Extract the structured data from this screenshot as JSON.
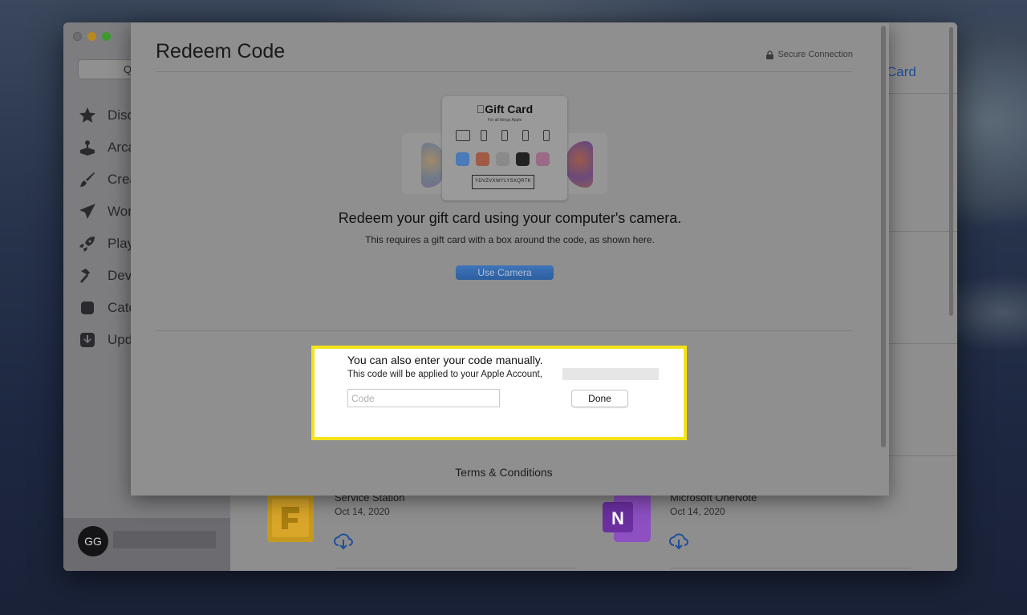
{
  "sidebar": {
    "search_hint": "Q",
    "items": [
      {
        "label": "Disc",
        "icon": "star-icon"
      },
      {
        "label": "Arca",
        "icon": "joystick-icon"
      },
      {
        "label": "Crea",
        "icon": "brush-icon"
      },
      {
        "label": "Wor",
        "icon": "paper-plane-icon"
      },
      {
        "label": "Play",
        "icon": "rocket-icon"
      },
      {
        "label": "Dev",
        "icon": "hammer-icon"
      },
      {
        "label": "Cate",
        "icon": "stack-icon"
      },
      {
        "label": "Upd",
        "icon": "download-arrow-icon"
      }
    ],
    "account": {
      "initials": "GG"
    }
  },
  "content": {
    "header_link": "Card",
    "apps": [
      {
        "name": "Service Station",
        "date": "Oct 14, 2020"
      },
      {
        "name": "Microsoft OneNote",
        "date": "Oct 14, 2020",
        "icon_letter": "N"
      }
    ]
  },
  "sheet": {
    "title": "Redeem Code",
    "secure_label": "Secure Connection",
    "gift_card": {
      "logo": "Gift Card",
      "tagline": "For all things Apple",
      "sample_code": "YDVZVXWYLYSXQRTK"
    },
    "camera_heading": "Redeem your gift card using your computer's camera.",
    "camera_sub": "This requires a gift card with a box around the code, as shown here.",
    "camera_button": "Use Camera",
    "manual_heading": "You can also enter your code manually.",
    "manual_sub": "This code will be applied to your Apple Account,",
    "code_placeholder": "Code",
    "done_button": "Done",
    "terms": "Terms & Conditions"
  },
  "colors": {
    "highlight": "#f5e31a",
    "accent": "#2d5f9f",
    "link": "#1e4f9a",
    "onenote": "#7b3bb0",
    "service_station": "#d9a62a"
  }
}
